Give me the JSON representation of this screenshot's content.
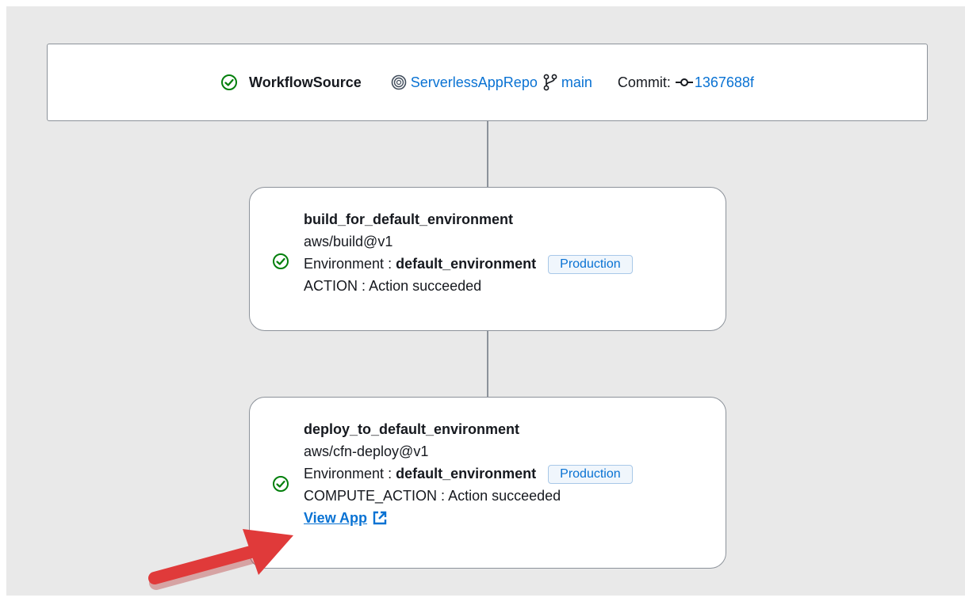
{
  "workflow_source": {
    "title": "WorkflowSource",
    "repo_label": "ServerlessAppRepo",
    "branch_label": "main",
    "commit_prefix": "Commit:",
    "commit_id": "1367688f"
  },
  "build_action": {
    "name": "build_for_default_environment",
    "action_id": "aws/build@v1",
    "environment_key": "Environment",
    "sep": ":",
    "environment_value": "default_environment",
    "environment_badge": "Production",
    "type_key": "ACTION",
    "status_text": "Action succeeded"
  },
  "deploy_action": {
    "name": "deploy_to_default_environment",
    "action_id": "aws/cfn-deploy@v1",
    "environment_key": "Environment",
    "sep": ":",
    "environment_value": "default_environment",
    "environment_badge": "Production",
    "type_key": "COMPUTE_ACTION",
    "status_text": "Action succeeded",
    "view_app_label": "View App"
  },
  "colors": {
    "success": "#037f0c",
    "link": "#0972d3",
    "annotation_arrow": "#e03a3a"
  }
}
